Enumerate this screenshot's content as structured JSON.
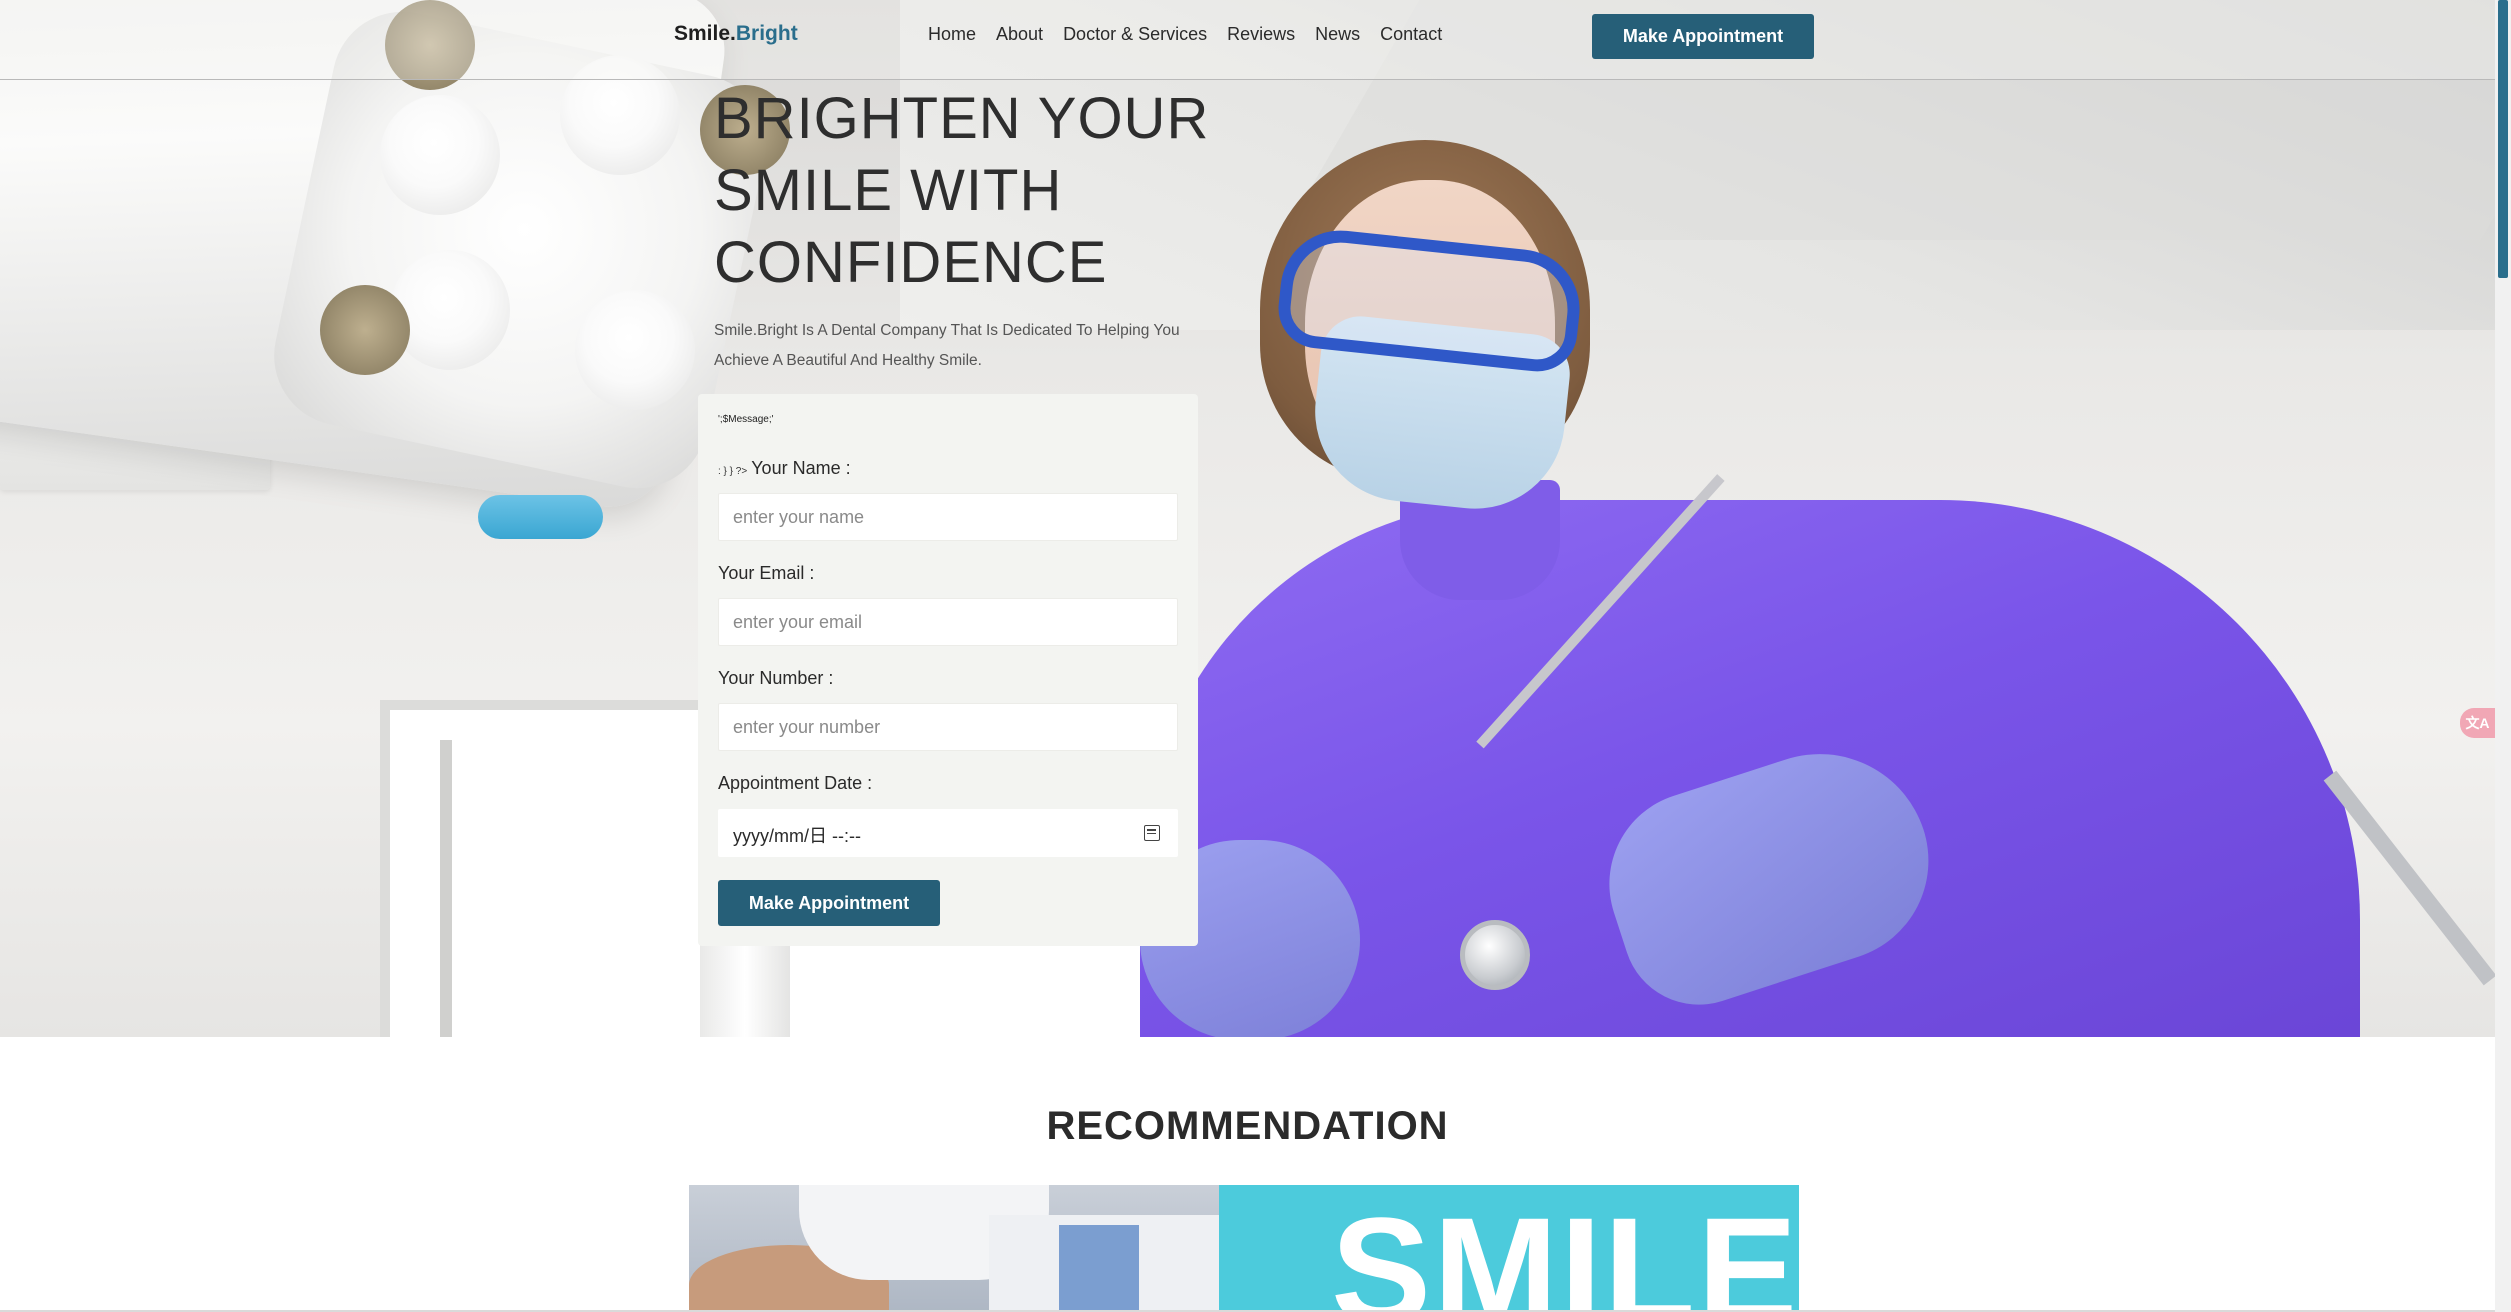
{
  "header": {
    "logo_main": "Smile.",
    "logo_accent": "Bright",
    "nav": [
      "Home",
      "About",
      "Doctor & Services",
      "Reviews",
      "News",
      "Contact"
    ],
    "cta_label": "Make Appointment"
  },
  "hero": {
    "title_line1": "BRIGHTEN YOUR",
    "title_line2": "SMILE WITH",
    "title_line3": "CONFIDENCE",
    "subtitle": "Smile.Bright Is A Dental Company That Is Dedicated To Helping You Achieve A Beautiful And Healthy Smile."
  },
  "form": {
    "message": "';$Message;'",
    "name_prefix": ": } } ?>",
    "name_label": "Your Name :",
    "name_placeholder": "enter your name",
    "email_label": "Your Email :",
    "email_placeholder": "enter your email",
    "number_label": "Your Number :",
    "number_placeholder": "enter your number",
    "date_label": "Appointment Date :",
    "date_placeholder": "yyyy/mm/日 --:--",
    "submit_label": "Make Appointment"
  },
  "recommendation": {
    "title": "RECOMMENDATION",
    "banner_text": "SMILE"
  },
  "widget": {
    "translate_glyph": "文A"
  },
  "colors": {
    "brand": "#265f78",
    "logo_accent": "#2a6e8c",
    "scrubs": "#7a55e9",
    "banner": "#4ccbdc"
  },
  "icons": [
    "calendar-icon",
    "translate-icon"
  ]
}
